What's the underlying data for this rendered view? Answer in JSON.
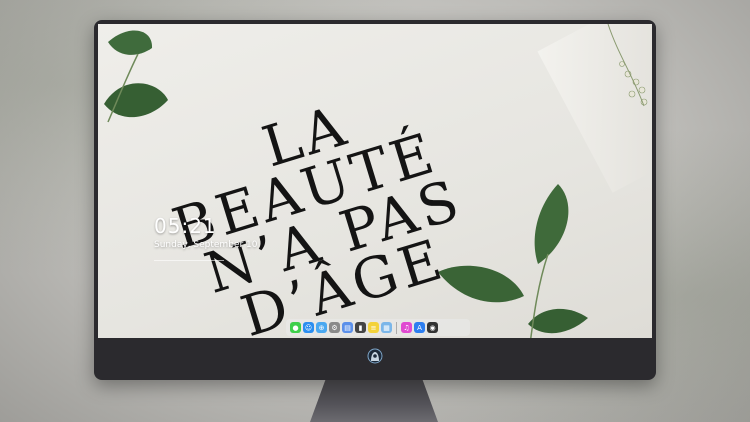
{
  "wallpaper": {
    "poster_lines": [
      "LA",
      "BEAUTÉ",
      "N’A PAS",
      "D’ÂGE"
    ]
  },
  "lockscreen": {
    "time": "05:21",
    "date": "Sunday, September 10"
  },
  "dock": {
    "items": [
      {
        "name": "messages-icon",
        "color": "#3ecf4a",
        "glyph": "●"
      },
      {
        "name": "finder-icon",
        "color": "#2b8ef0",
        "glyph": "☺"
      },
      {
        "name": "safari-icon",
        "color": "#4aa8f0",
        "glyph": "⊕"
      },
      {
        "name": "system-preferences-icon",
        "color": "#8a8a8a",
        "glyph": "⚙"
      },
      {
        "name": "keynote-icon",
        "color": "#5c90ea",
        "glyph": "▤"
      },
      {
        "name": "clapper-icon",
        "color": "#444444",
        "glyph": "▮"
      },
      {
        "name": "notes-icon",
        "color": "#f3d23a",
        "glyph": "≡"
      },
      {
        "name": "photos-icon",
        "color": "#7bb6e9",
        "glyph": "▦"
      },
      {
        "name": "itunes-icon",
        "color": "#e04ad1",
        "glyph": "♫"
      },
      {
        "name": "app-store-icon",
        "color": "#2c7ef0",
        "glyph": "A"
      },
      {
        "name": "camera-icon",
        "color": "#333333",
        "glyph": "◉"
      }
    ]
  }
}
